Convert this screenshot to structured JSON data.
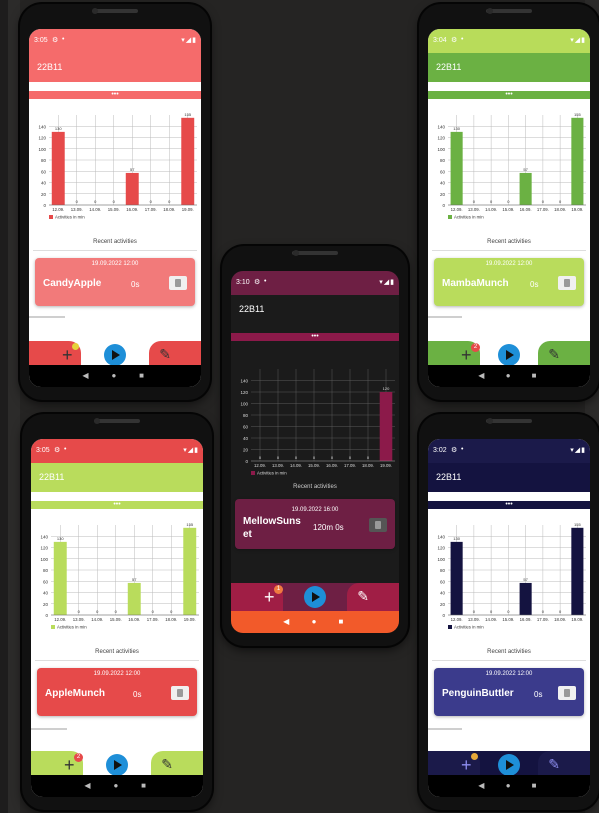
{
  "screens": [
    {
      "id": "candy",
      "status_time": "3:05",
      "app_title": "22B11",
      "strip_dots": "•••",
      "recent_label": "Recent activities",
      "card": {
        "date": "19.09.2022 12:00",
        "name": "CandyApple",
        "name2": "",
        "duration": "0s"
      },
      "badge": "",
      "colors": {
        "status": "#f56b6b",
        "appbar": "#f56b6b",
        "strip": "#f56b6b",
        "bar": "#e64a4a",
        "card": "#f27a7a",
        "bottom": "#e64a4a",
        "play": "#1e8fd8",
        "badge": "#e6d23a"
      }
    },
    {
      "id": "mamba",
      "status_time": "3:04",
      "app_title": "22B11",
      "strip_dots": "•••",
      "recent_label": "Recent activities",
      "card": {
        "date": "19.09.2022 12:00",
        "name": "MambaMunch",
        "name2": "",
        "duration": "0s"
      },
      "badge": "2",
      "colors": {
        "status": "#b8dc5a",
        "appbar": "#6bb143",
        "strip": "#6bb143",
        "bar": "#6bb143",
        "card": "#b9dc5c",
        "bottom": "#6bb143",
        "play": "#1e8fd8",
        "badge": "#e64a4a"
      }
    },
    {
      "id": "mellow",
      "status_time": "3:10",
      "app_title": "22B11",
      "strip_dots": "•••",
      "recent_label": "Recent activities",
      "card": {
        "date": "19.09.2022 16:00",
        "name": "MellowSuns",
        "name2": "et",
        "duration": "120m 0s"
      },
      "badge": "1",
      "colors": {
        "status": "#6e1f44",
        "appbar": "#1b1b1b",
        "strip": "#8c1a4a",
        "bar": "#8c1a4a",
        "card": "#6e1f44",
        "bottom": "#a01e45",
        "play": "#1e8fd8",
        "badge": "#f07a40"
      }
    },
    {
      "id": "apple",
      "status_time": "3:05",
      "app_title": "22B11",
      "strip_dots": "•••",
      "recent_label": "Recent activities",
      "card": {
        "date": "19.09.2022 12:00",
        "name": "AppleMunch",
        "name2": "",
        "duration": "0s"
      },
      "badge": "2",
      "colors": {
        "status": "#e64a4a",
        "appbar": "#b9dc5c",
        "strip": "#b9dc5c",
        "bar": "#b9dc5c",
        "card": "#e64a4a",
        "bottom": "#b9dc5c",
        "play": "#1e8fd8",
        "badge": "#e64a4a"
      }
    },
    {
      "id": "penguin",
      "status_time": "3:02",
      "app_title": "22B11",
      "strip_dots": "•••",
      "recent_label": "Recent activities",
      "card": {
        "date": "19.09.2022 12:00",
        "name": "PenguinButtler",
        "name2": "",
        "duration": "0s"
      },
      "badge": "",
      "colors": {
        "status": "#1b1a4a",
        "appbar": "#141340",
        "strip": "#141340",
        "bar": "#141340",
        "card": "#3b3b8c",
        "bottom": "#1b1a4a",
        "play": "#1e8fd8",
        "badge": "#e6a83a"
      }
    }
  ],
  "icons": {
    "gear": "gear-icon",
    "signal": "signal-icon",
    "plus": "plus-icon",
    "play": "play-icon",
    "pencil": "pencil-icon",
    "trash": "trash-icon",
    "back": "back-icon",
    "home": "home-icon",
    "recents": "recents-icon"
  },
  "chart_data": {
    "type": "bar",
    "categories": [
      "12.09.",
      "13.09.",
      "14.09.",
      "15.09.",
      "16.09.",
      "17.09.",
      "18.09.",
      "19.09."
    ],
    "ylim": [
      0,
      160
    ],
    "yticks": [
      0,
      20,
      40,
      60,
      80,
      100,
      120,
      140
    ],
    "legend": "Activities in min",
    "series_standard": [
      130,
      0,
      0,
      0,
      57,
      0,
      0,
      155
    ],
    "series_mellow": [
      0,
      0,
      0,
      0,
      0,
      0,
      0,
      120
    ],
    "bar_labels_standard": [
      "130",
      "0",
      "0",
      "0",
      "57",
      "0",
      "0",
      "155"
    ],
    "bar_labels_mellow": [
      "0",
      "0",
      "0",
      "0",
      "0",
      "0",
      "0",
      "120"
    ]
  }
}
